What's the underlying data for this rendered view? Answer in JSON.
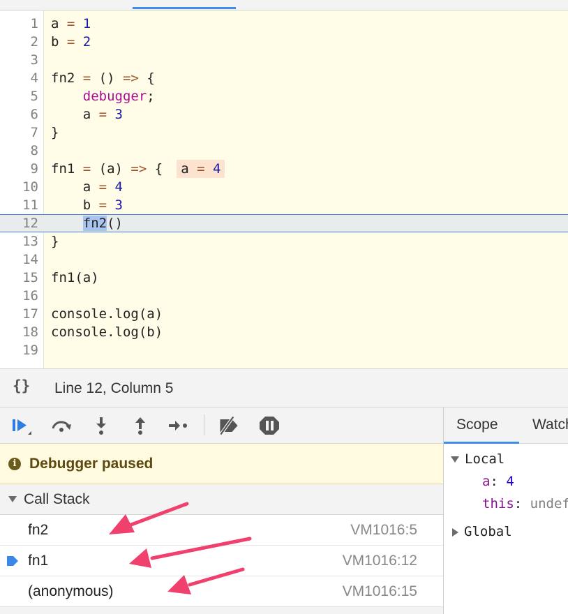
{
  "editor": {
    "lines": [
      {
        "num": "1",
        "code": [
          {
            "t": "a ",
            "c": "var"
          },
          {
            "t": "=",
            "c": "op"
          },
          {
            "t": " ",
            "c": "var"
          },
          {
            "t": "1",
            "c": "num"
          }
        ]
      },
      {
        "num": "2",
        "code": [
          {
            "t": "b ",
            "c": "var"
          },
          {
            "t": "=",
            "c": "op"
          },
          {
            "t": " ",
            "c": "var"
          },
          {
            "t": "2",
            "c": "num"
          }
        ]
      },
      {
        "num": "3",
        "code": []
      },
      {
        "num": "4",
        "code": [
          {
            "t": "fn2 ",
            "c": "var"
          },
          {
            "t": "=",
            "c": "op"
          },
          {
            "t": " () ",
            "c": "var"
          },
          {
            "t": "=>",
            "c": "op"
          },
          {
            "t": " {",
            "c": "var"
          }
        ]
      },
      {
        "num": "5",
        "code": [
          {
            "t": "    ",
            "c": "var"
          },
          {
            "t": "debugger",
            "c": "kw"
          },
          {
            "t": ";",
            "c": "var"
          }
        ]
      },
      {
        "num": "6",
        "code": [
          {
            "t": "    a ",
            "c": "var"
          },
          {
            "t": "=",
            "c": "op"
          },
          {
            "t": " ",
            "c": "var"
          },
          {
            "t": "3",
            "c": "num"
          }
        ]
      },
      {
        "num": "7",
        "code": [
          {
            "t": "}",
            "c": "var"
          }
        ]
      },
      {
        "num": "8",
        "code": []
      },
      {
        "num": "9",
        "code": [
          {
            "t": "fn1 ",
            "c": "var"
          },
          {
            "t": "=",
            "c": "op"
          },
          {
            "t": " (a) ",
            "c": "var"
          },
          {
            "t": "=>",
            "c": "op"
          },
          {
            "t": " {",
            "c": "var"
          }
        ],
        "inline_value": {
          "name": "a",
          "op": "=",
          "value": "4"
        }
      },
      {
        "num": "10",
        "code": [
          {
            "t": "    a ",
            "c": "var"
          },
          {
            "t": "=",
            "c": "op"
          },
          {
            "t": " ",
            "c": "var"
          },
          {
            "t": "4",
            "c": "num"
          }
        ]
      },
      {
        "num": "11",
        "code": [
          {
            "t": "    b ",
            "c": "var"
          },
          {
            "t": "=",
            "c": "op"
          },
          {
            "t": " ",
            "c": "var"
          },
          {
            "t": "3",
            "c": "num"
          }
        ]
      },
      {
        "num": "12",
        "code": [
          {
            "t": "    ",
            "c": "var"
          },
          {
            "t": "fn2",
            "c": "sel"
          },
          {
            "t": "()",
            "c": "var"
          }
        ],
        "current": true
      },
      {
        "num": "13",
        "code": [
          {
            "t": "}",
            "c": "var"
          }
        ]
      },
      {
        "num": "14",
        "code": []
      },
      {
        "num": "15",
        "code": [
          {
            "t": "fn1(a)",
            "c": "var"
          }
        ]
      },
      {
        "num": "16",
        "code": []
      },
      {
        "num": "17",
        "code": [
          {
            "t": "console.log(a)",
            "c": "var"
          }
        ]
      },
      {
        "num": "18",
        "code": [
          {
            "t": "console.log(b)",
            "c": "var"
          }
        ]
      },
      {
        "num": "19",
        "code": []
      }
    ]
  },
  "status": {
    "pretty_print_icon": "curly-braces-icon",
    "position": "Line 12, Column 5"
  },
  "toolbar": {
    "buttons": [
      {
        "name": "resume-button",
        "icon": "resume-icon"
      },
      {
        "name": "step-over-button",
        "icon": "step-over-icon"
      },
      {
        "name": "step-into-button",
        "icon": "step-into-icon"
      },
      {
        "name": "step-out-button",
        "icon": "step-out-icon"
      },
      {
        "name": "step-button",
        "icon": "step-icon"
      },
      {
        "name": "deactivate-breakpoints-button",
        "icon": "deactivate-breakpoints-icon"
      },
      {
        "name": "pause-on-exceptions-button",
        "icon": "pause-on-exceptions-icon"
      }
    ]
  },
  "paused": {
    "icon": "info-icon",
    "text": "Debugger paused"
  },
  "call_stack": {
    "title": "Call Stack",
    "frames": [
      {
        "name": "fn2",
        "location": "VM1016:5",
        "current": false
      },
      {
        "name": "fn1",
        "location": "VM1016:12",
        "current": true
      },
      {
        "name": "(anonymous)",
        "location": "VM1016:15",
        "current": false
      }
    ]
  },
  "scope": {
    "tabs": [
      "Scope",
      "Watch"
    ],
    "local": {
      "label": "Local",
      "props": [
        {
          "name": "a",
          "value": "4",
          "kind": "num"
        },
        {
          "name": "this",
          "value": "undefined",
          "kind": "undef"
        }
      ]
    },
    "global": {
      "label": "Global"
    }
  },
  "colors": {
    "accent": "#3c8ee6",
    "annotation_arrow": "#f0406e",
    "paused_bg": "#fffae0",
    "editor_bg": "#fffde8"
  }
}
